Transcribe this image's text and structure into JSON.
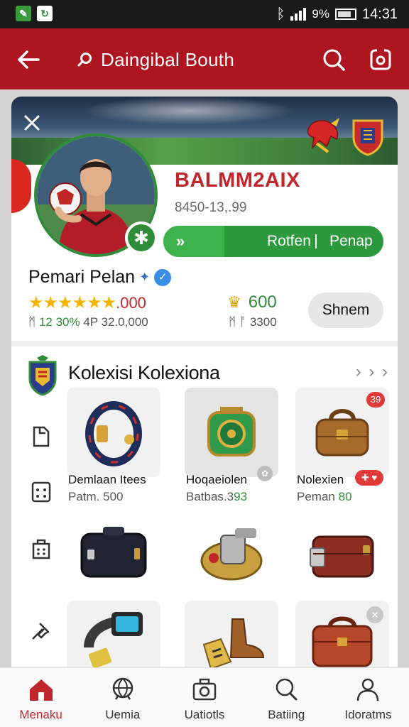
{
  "status_bar": {
    "battery": "9%",
    "time": "14:31"
  },
  "app_bar": {
    "title": "Daingibal Bouth"
  },
  "profile": {
    "player_name": "BALMM2AIX",
    "player_id": "8450-13,.99",
    "progress": {
      "arrow": "»",
      "label_left": "Rotfen",
      "label_right": "Penap"
    },
    "owner_name": "Pemari Pelan",
    "rating_value": ".000",
    "rating_stars": 5,
    "stats_left_prefix": "ᛗ",
    "stats_left_green": "12 30%",
    "stats_left_rest": "4P  32.0,000",
    "coins": "600",
    "coins_sub": "ᛗ ᚩ 3300",
    "action_label": "Shnem"
  },
  "collection": {
    "title": "Kolexisi Kolexiona",
    "more": "› › ›",
    "items": [
      {
        "name": "Demlaan Itees",
        "price": "Patm. 500",
        "price_green": ""
      },
      {
        "name": "Hoqaeiolen",
        "price": "Batbas.3",
        "price_green": "93"
      },
      {
        "name": "Nolexien",
        "price": "Peman",
        "price_green": "80",
        "badge": "39"
      },
      {
        "name": "",
        "price": "",
        "price_green": ""
      },
      {
        "name": "",
        "price": "",
        "price_green": ""
      },
      {
        "name": "",
        "price": "",
        "price_green": ""
      },
      {
        "name": "",
        "price": "",
        "price_green": ""
      },
      {
        "name": "",
        "price": "",
        "price_green": ""
      },
      {
        "name": "",
        "price": "",
        "price_green": ""
      }
    ]
  },
  "bottom_nav": [
    {
      "label": "Menaku",
      "icon": "home-icon",
      "active": true
    },
    {
      "label": "Uemia",
      "icon": "globe-icon",
      "active": false
    },
    {
      "label": "Uatiotls",
      "icon": "camera-icon",
      "active": false
    },
    {
      "label": "Batiing",
      "icon": "search-icon",
      "active": false
    },
    {
      "label": "Idoratms",
      "icon": "person-icon",
      "active": false
    }
  ],
  "colors": {
    "brand_red": "#ad1521",
    "accent_green": "#2f8d3a",
    "star_gold": "#f5b400"
  }
}
